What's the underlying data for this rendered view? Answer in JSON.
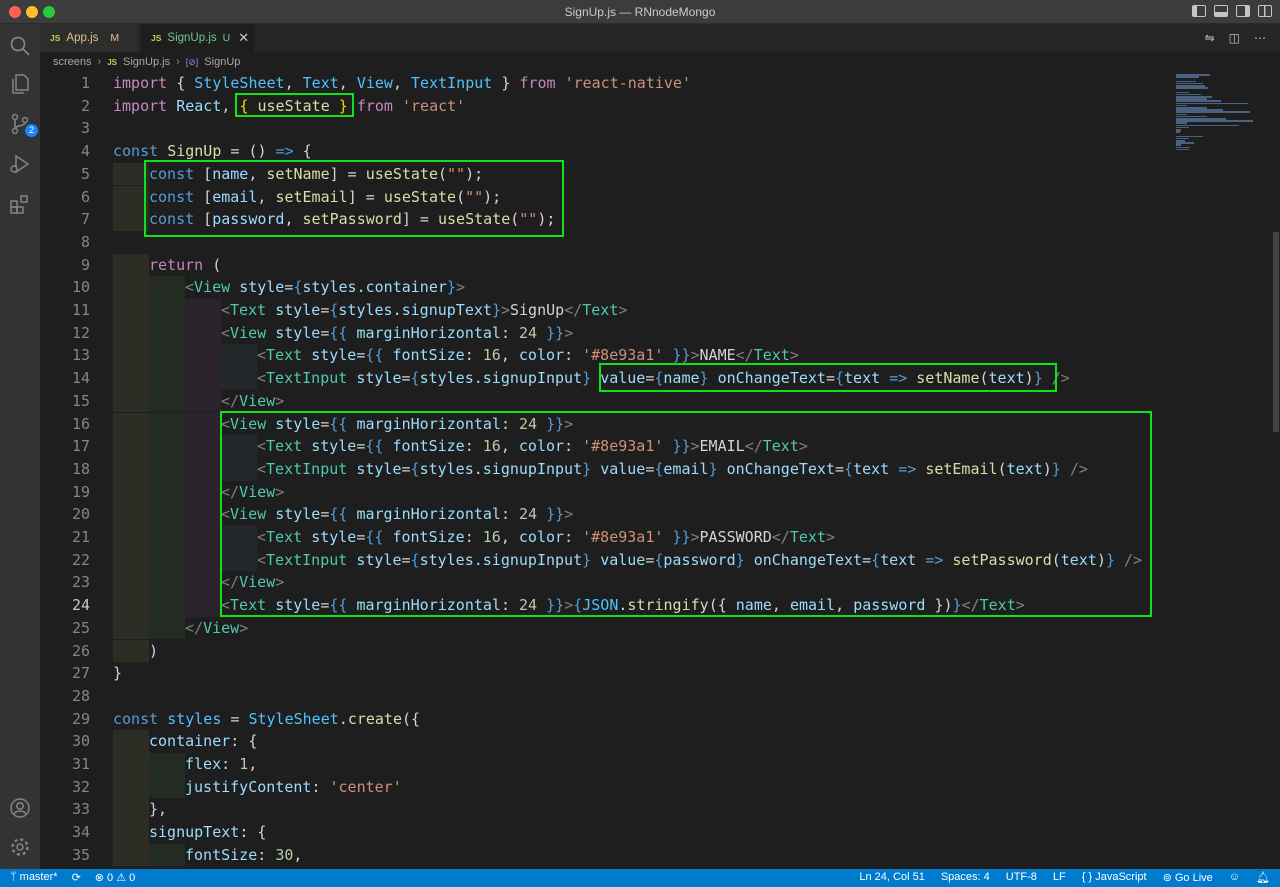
{
  "window": {
    "title": "SignUp.js — RNnodeMongo"
  },
  "tabs": [
    {
      "label": "App.js",
      "status": "M",
      "icon": "JS"
    },
    {
      "label": "SignUp.js",
      "status": "U",
      "icon": "JS"
    }
  ],
  "breadcrumb": {
    "folder": "screens",
    "file": "SignUp.js",
    "symbol": "SignUp"
  },
  "activity": {
    "scm_badge": "2"
  },
  "line_numbers": [
    "1",
    "2",
    "3",
    "4",
    "5",
    "6",
    "7",
    "8",
    "9",
    "10",
    "11",
    "12",
    "13",
    "14",
    "15",
    "16",
    "17",
    "18",
    "19",
    "20",
    "21",
    "22",
    "23",
    "24",
    "25",
    "26",
    "27",
    "28",
    "29",
    "30",
    "31",
    "32",
    "33",
    "34",
    "35"
  ],
  "code": {
    "l1": [
      "import",
      " { ",
      "StyleSheet",
      ", ",
      "Text",
      ", ",
      "View",
      ", ",
      "TextInput",
      " } ",
      "from",
      " ",
      "'react-native'"
    ],
    "l2": [
      "import",
      " ",
      "React",
      ", ",
      "{",
      " ",
      "useState",
      " ",
      "}",
      " ",
      "from",
      " ",
      "'react'"
    ],
    "l4": [
      "const",
      " ",
      "SignUp",
      " = () ",
      "=>",
      " {"
    ],
    "l5": [
      "const",
      " [",
      "name",
      ", ",
      "setName",
      "] = ",
      "useState",
      "(",
      "\"\"",
      ");"
    ],
    "l6": [
      "const",
      " [",
      "email",
      ", ",
      "setEmail",
      "] = ",
      "useState",
      "(",
      "\"\"",
      ");"
    ],
    "l7": [
      "const",
      " [",
      "password",
      ", ",
      "setPassword",
      "] = ",
      "useState",
      "(",
      "\"\"",
      ");"
    ],
    "l9": [
      "return",
      " ("
    ],
    "l10": [
      "<",
      "View",
      " ",
      "style",
      "=",
      "{",
      "styles",
      ".",
      "container",
      "}",
      ">"
    ],
    "l11": [
      "<",
      "Text",
      " ",
      "style",
      "=",
      "{",
      "styles",
      ".",
      "signupText",
      "}",
      ">",
      "SignUp",
      "</",
      "Text",
      ">"
    ],
    "l12": [
      "<",
      "View",
      " ",
      "style",
      "=",
      "{{",
      " ",
      "marginHorizontal",
      ": ",
      "24",
      " ",
      "}}",
      ">"
    ],
    "l13": [
      "<",
      "Text",
      " ",
      "style",
      "=",
      "{{",
      " ",
      "fontSize",
      ": ",
      "16",
      ", ",
      "color",
      ": ",
      "'#8e93a1'",
      " ",
      "}}",
      ">",
      "NAME",
      "</",
      "Text",
      ">"
    ],
    "l14": [
      "<",
      "TextInput",
      " ",
      "style",
      "=",
      "{",
      "styles",
      ".",
      "signupInput",
      "}",
      " ",
      "value",
      "=",
      "{",
      "name",
      "}",
      " ",
      "onChangeText",
      "=",
      "{",
      "text",
      " ",
      "=>",
      " ",
      "setName",
      "(",
      "text",
      ")",
      "}",
      " ",
      "/>"
    ],
    "l15": [
      "</",
      "View",
      ">"
    ],
    "l16": [
      "<",
      "View",
      " ",
      "style",
      "=",
      "{{",
      " ",
      "marginHorizontal",
      ": ",
      "24",
      " ",
      "}}",
      ">"
    ],
    "l17": [
      "<",
      "Text",
      " ",
      "style",
      "=",
      "{{",
      " ",
      "fontSize",
      ": ",
      "16",
      ", ",
      "color",
      ": ",
      "'#8e93a1'",
      " ",
      "}}",
      ">",
      "EMAIL",
      "</",
      "Text",
      ">"
    ],
    "l18": [
      "<",
      "TextInput",
      " ",
      "style",
      "=",
      "{",
      "styles",
      ".",
      "signupInput",
      "}",
      " ",
      "value",
      "=",
      "{",
      "email",
      "}",
      " ",
      "onChangeText",
      "=",
      "{",
      "text",
      " ",
      "=>",
      " ",
      "setEmail",
      "(",
      "text",
      ")",
      "}",
      " ",
      "/>"
    ],
    "l19": [
      "</",
      "View",
      ">"
    ],
    "l20": [
      "<",
      "View",
      " ",
      "style",
      "=",
      "{{",
      " ",
      "marginHorizontal",
      ": ",
      "24",
      " ",
      "}}",
      ">"
    ],
    "l21": [
      "<",
      "Text",
      " ",
      "style",
      "=",
      "{{",
      " ",
      "fontSize",
      ": ",
      "16",
      ", ",
      "color",
      ": ",
      "'#8e93a1'",
      " ",
      "}}",
      ">",
      "PASSWORD",
      "</",
      "Text",
      ">"
    ],
    "l22": [
      "<",
      "TextInput",
      " ",
      "style",
      "=",
      "{",
      "styles",
      ".",
      "signupInput",
      "}",
      " ",
      "value",
      "=",
      "{",
      "password",
      "}",
      " ",
      "onChangeText",
      "=",
      "{",
      "text",
      " ",
      "=>",
      " ",
      "setPassword",
      "(",
      "text",
      ")",
      "}",
      " ",
      "/>"
    ],
    "l23": [
      "</",
      "View",
      ">"
    ],
    "l24": [
      "<",
      "Text",
      " ",
      "style",
      "=",
      "{{",
      " ",
      "marginHorizontal",
      ": ",
      "24",
      " ",
      "}}",
      ">",
      "{",
      "JSON",
      ".",
      "stringify",
      "({ ",
      "name",
      ", ",
      "email",
      ", ",
      "password",
      " })",
      "}",
      "</",
      "Text",
      ">"
    ],
    "l25": [
      "</",
      "View",
      ">"
    ],
    "l26": [
      ")"
    ],
    "l27": [
      "}"
    ],
    "l29": [
      "const",
      " ",
      "styles",
      " = ",
      "StyleSheet",
      ".",
      "create",
      "({"
    ],
    "l30": [
      "container",
      ": {"
    ],
    "l31": [
      "flex",
      ": ",
      "1",
      ","
    ],
    "l32": [
      "justifyContent",
      ": ",
      "'center'"
    ],
    "l33": [
      "},"
    ],
    "l34": [
      "signupText",
      ": {"
    ],
    "l35": [
      "fontSize",
      ": ",
      "30",
      ","
    ]
  },
  "status": {
    "branch": "master*",
    "sync": "⟳",
    "problems": "⊗ 0 ⚠ 0",
    "position": "Ln 24, Col 51",
    "spaces": "Spaces: 4",
    "encoding": "UTF-8",
    "eol": "LF",
    "language": "{ } JavaScript",
    "golive": "Go Live"
  },
  "colors": {
    "highlight": "#12e01b",
    "statusbar": "#007acc"
  }
}
